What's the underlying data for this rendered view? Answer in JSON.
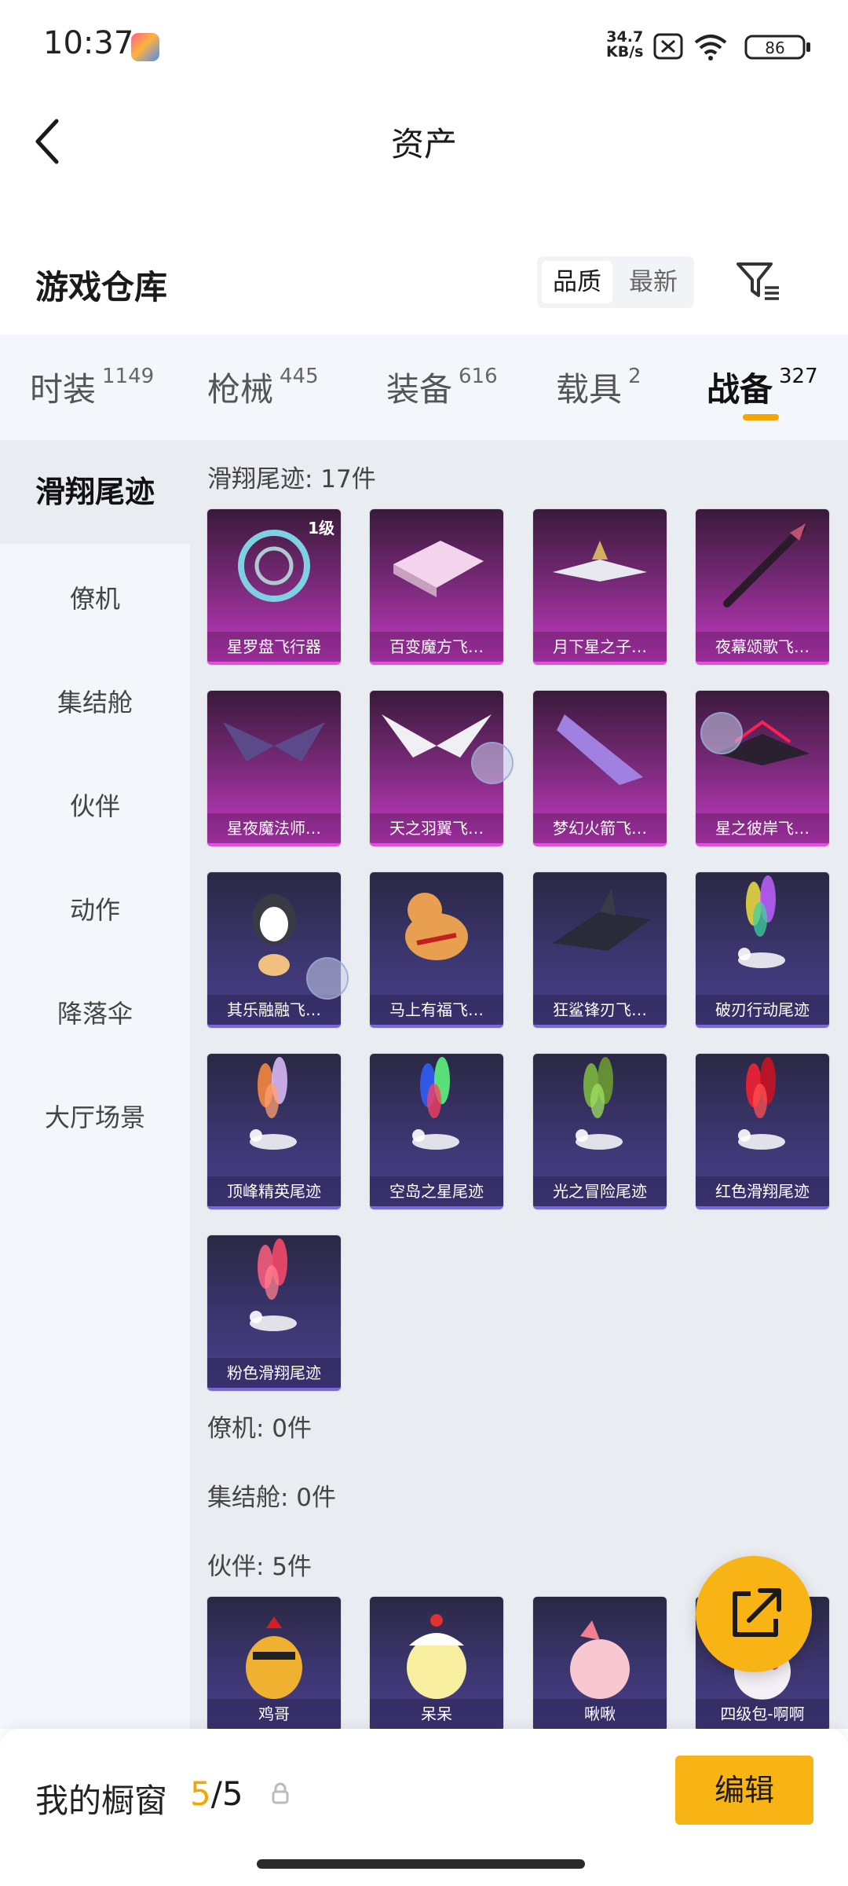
{
  "status_bar": {
    "time": "10:37",
    "net_speed_value": "34.7",
    "net_speed_unit": "KB/s",
    "battery": "86"
  },
  "header": {
    "title": "资产"
  },
  "warehouse": {
    "title": "游戏仓库",
    "sort_quality": "品质",
    "sort_newest": "最新"
  },
  "tabs": [
    {
      "label": "时装",
      "count": "1149"
    },
    {
      "label": "枪械",
      "count": "445"
    },
    {
      "label": "装备",
      "count": "616"
    },
    {
      "label": "载具",
      "count": "2"
    },
    {
      "label": "战备",
      "count": "327"
    }
  ],
  "sidebar": [
    "滑翔尾迹",
    "僚机",
    "集结舱",
    "伙伴",
    "动作",
    "降落伞",
    "大厅场景"
  ],
  "sections": {
    "glide": "滑翔尾迹: 17件",
    "wingman": "僚机: 0件",
    "capsule": "集结舱: 0件",
    "partner": "伙伴: 5件"
  },
  "glide_items": [
    {
      "name": "星罗盘飞行器",
      "badge": "1级",
      "rarity": "pink",
      "art": "compass"
    },
    {
      "name": "百变魔方飞…",
      "rarity": "pink",
      "art": "cube"
    },
    {
      "name": "月下星之子…",
      "rarity": "pink",
      "art": "plane"
    },
    {
      "name": "夜幕颂歌飞…",
      "rarity": "pink",
      "art": "spear"
    },
    {
      "name": "星夜魔法师…",
      "rarity": "pink",
      "art": "wings-dark"
    },
    {
      "name": "天之羽翼飞…",
      "rarity": "pink",
      "art": "wings-white"
    },
    {
      "name": "梦幻火箭飞…",
      "rarity": "pink",
      "art": "rocket"
    },
    {
      "name": "星之彼岸飞…",
      "rarity": "pink",
      "art": "jet"
    },
    {
      "name": "其乐融融飞…",
      "rarity": "blue",
      "art": "penguin"
    },
    {
      "name": "马上有福飞…",
      "rarity": "blue",
      "art": "horse"
    },
    {
      "name": "狂鲨锋刃飞…",
      "rarity": "blue",
      "art": "shark"
    },
    {
      "name": "破刃行动尾迹",
      "rarity": "blue",
      "art": "trail-rainbow"
    },
    {
      "name": "顶峰精英尾迹",
      "rarity": "blue",
      "art": "trail-orange"
    },
    {
      "name": "空岛之星尾迹",
      "rarity": "blue",
      "art": "trail-spectrum"
    },
    {
      "name": "光之冒险尾迹",
      "rarity": "blue",
      "art": "trail-green"
    },
    {
      "name": "红色滑翔尾迹",
      "rarity": "blue",
      "art": "trail-red"
    },
    {
      "name": "粉色滑翔尾迹",
      "rarity": "blue",
      "art": "trail-pink"
    }
  ],
  "partner_items": [
    {
      "name": "鸡哥",
      "rarity": "blue",
      "art": "chicken"
    },
    {
      "name": "呆呆",
      "rarity": "blue",
      "art": "chick"
    },
    {
      "name": "啾啾",
      "rarity": "blue",
      "art": "pink-bird"
    },
    {
      "name": "四级包-啊啊",
      "rarity": "blue",
      "art": "white-pet"
    }
  ],
  "bottom_bar": {
    "label": "我的橱窗",
    "count_current": "5",
    "count_sep_total": "/5",
    "edit_label": "编辑"
  },
  "colors": {
    "accent": "#f5a700",
    "epic": "#c43ac4",
    "rare": "#4a3f8c"
  }
}
